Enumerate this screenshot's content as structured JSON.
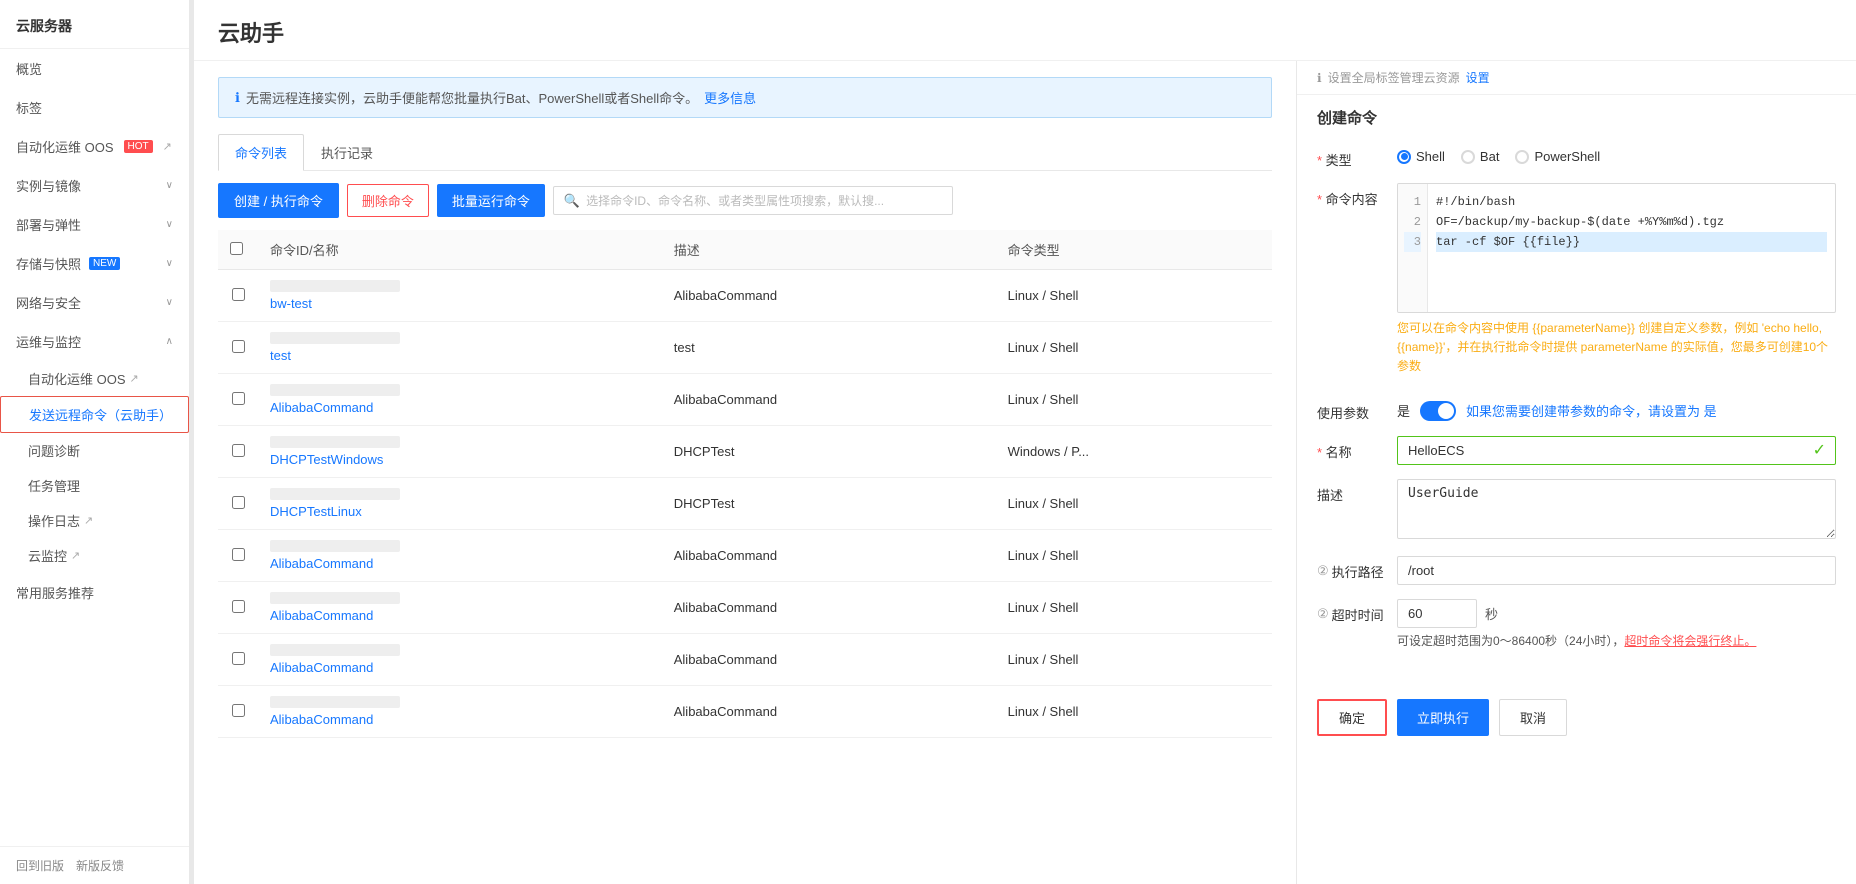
{
  "sidebar": {
    "top_label": "云服务器",
    "items": [
      {
        "id": "overview",
        "label": "概览",
        "type": "item"
      },
      {
        "id": "tags",
        "label": "标签",
        "type": "item"
      },
      {
        "id": "automation",
        "label": "自动化运维 OOS",
        "type": "item",
        "badge": "HOT"
      },
      {
        "id": "instances",
        "label": "实例与镜像",
        "type": "section",
        "expanded": false
      },
      {
        "id": "deploy",
        "label": "部署与弹性",
        "type": "section",
        "expanded": false
      },
      {
        "id": "storage",
        "label": "存储与快照",
        "type": "section",
        "expanded": false,
        "badge": "NEW"
      },
      {
        "id": "network",
        "label": "网络与安全",
        "type": "section",
        "expanded": false
      },
      {
        "id": "ops",
        "label": "运维与监控",
        "type": "section",
        "expanded": true
      },
      {
        "id": "ops-automation",
        "label": "自动化运维 OOS",
        "type": "sub"
      },
      {
        "id": "cloud-assistant",
        "label": "发送远程命令（云助手）",
        "type": "sub",
        "active": true
      },
      {
        "id": "problem-diagnosis",
        "label": "问题诊断",
        "type": "sub"
      },
      {
        "id": "task-management",
        "label": "任务管理",
        "type": "sub"
      },
      {
        "id": "operation-log",
        "label": "操作日志",
        "type": "sub"
      },
      {
        "id": "cloud-monitor",
        "label": "云监控",
        "type": "sub"
      },
      {
        "id": "common-services",
        "label": "常用服务推荐",
        "type": "item"
      }
    ],
    "footer": {
      "old_version": "回到旧版",
      "feedback": "新版反馈"
    }
  },
  "main": {
    "title": "云助手",
    "info_banner": {
      "text": "无需远程连接实例，云助手便能帮您批量执行Bat、PowerShell或者Shell命令。",
      "link_text": "更多信息"
    },
    "tabs": [
      {
        "id": "command-list",
        "label": "命令列表",
        "active": true
      },
      {
        "id": "execution-records",
        "label": "执行记录",
        "active": false
      }
    ],
    "toolbar": {
      "create_btn": "创建 / 执行命令",
      "delete_btn": "删除命令",
      "batch_btn": "批量运行命令",
      "search_placeholder": "选择命令ID、命令名称、或者类型属性项搜索，默认搜..."
    },
    "table": {
      "columns": [
        "命令ID/名称",
        "描述",
        "命令类型"
      ],
      "rows": [
        {
          "id_blur": true,
          "name": "bw-test",
          "desc": "AlibabaCommand",
          "type": "Linux / Shell"
        },
        {
          "id_blur": true,
          "name": "test",
          "desc": "test",
          "type": "Linux / Shell"
        },
        {
          "id_blur": true,
          "name": "c-b22...",
          "name_full": "AlibabaCommand",
          "desc": "AlibabaCommand",
          "type": "Linux / Shell"
        },
        {
          "id_blur": true,
          "name": "c-b0...",
          "name_full": "DHCPTestWindows",
          "desc": "DHCPTest",
          "type": "Windows / P..."
        },
        {
          "id_blur": true,
          "name": "c-0...",
          "name_full": "DHCPTestLinux",
          "desc": "DHCPTest",
          "type": "Linux / Shell"
        },
        {
          "id_blur": true,
          "name": "c-c...",
          "name_full": "AlibabaCommand",
          "desc": "AlibabaCommand",
          "type": "Linux / Shell"
        },
        {
          "id_blur": true,
          "name": "c-4...",
          "name_full": "AlibabaCommand",
          "desc": "AlibabaCommand",
          "type": "Linux / Shell"
        },
        {
          "id_blur": true,
          "name": "c-e...",
          "name_full": "AlibabaCommand",
          "desc": "AlibabaCommand",
          "type": "Linux / Shell"
        },
        {
          "id_blur": true,
          "name": "c-cd...",
          "name_full": "AlibabaCommand",
          "desc": "AlibabaCommand",
          "type": "Linux / Shell"
        }
      ]
    }
  },
  "right_panel": {
    "top_bar": {
      "info_icon": "ℹ",
      "text": "设置全局标签管理云资源",
      "link_text": "设置"
    },
    "title": "创建命令",
    "form": {
      "type_label": "类型",
      "type_options": [
        {
          "value": "Shell",
          "selected": true
        },
        {
          "value": "Bat",
          "selected": false
        },
        {
          "value": "PowerShell",
          "selected": false
        }
      ],
      "content_label": "命令内容",
      "code_lines": [
        "#!/bin/bash",
        "OF=/backup/my-backup-$(date +%Y%m%d).tgz",
        "tar -cf $OF {{file}}"
      ],
      "hint_text": "您可以在命令内容中使用 {{parameterName}} 创建自定义参数，例如 'echo hello,{{name}}'，并在执行批命令时提供 parameterName 的实际值，您最多可创建10个参数",
      "use_params_label": "使用参数",
      "use_params_toggle": true,
      "use_params_hint": "如果您需要创建带参数的命令，请设置为 是",
      "name_label": "名称",
      "name_value": "HelloECS",
      "desc_label": "描述",
      "desc_value": "UserGuide",
      "exec_path_label": "执行路径",
      "exec_path_question": "②",
      "exec_path_value": "/root",
      "timeout_label": "超时时间",
      "timeout_question": "②",
      "timeout_value": "60",
      "timeout_unit": "秒",
      "timeout_hint": "可设定超时范围为0～86400秒（24小时），",
      "timeout_hint_link": "超时命令将会强行终止。"
    },
    "footer": {
      "confirm_btn": "确定",
      "execute_btn": "立即执行",
      "cancel_btn": "取消"
    }
  }
}
